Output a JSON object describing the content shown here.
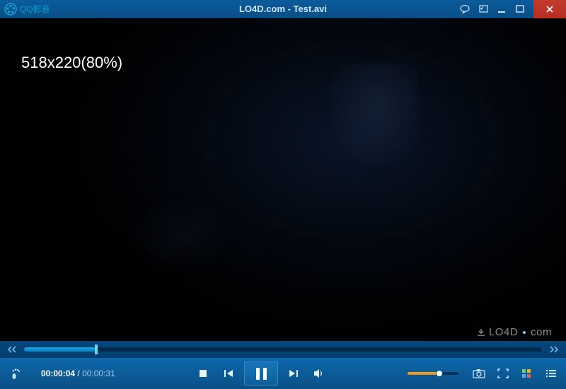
{
  "titlebar": {
    "app_name": "QQ影音",
    "document_title": "LO4D.com - Test.avi"
  },
  "video": {
    "overlay_text": "518x220(80%)"
  },
  "watermark": {
    "text_left": "LO4D",
    "text_right": "com"
  },
  "seek": {
    "progress_pct": 14
  },
  "time": {
    "elapsed": "00:00:04",
    "separator": " / ",
    "total": "00:00:31"
  },
  "volume": {
    "level_pct": 62
  },
  "icons": {
    "comment": "comment-icon",
    "resize": "resize-icon",
    "minimize": "minimize-icon",
    "maximize": "maximize-icon",
    "close": "close-icon"
  }
}
